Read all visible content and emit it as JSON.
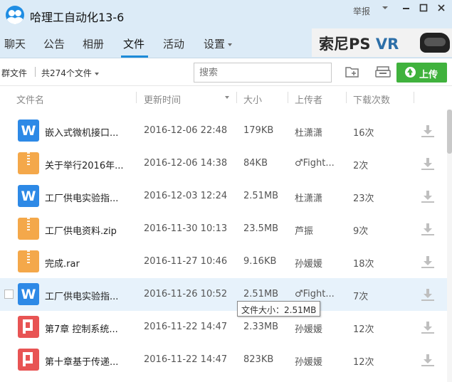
{
  "window": {
    "title": "哈理工自动化13-6",
    "report_label": "举报",
    "controls": [
      "chevron-down-icon",
      "minimize-icon",
      "maximize-icon",
      "close-icon"
    ]
  },
  "nav": {
    "tabs": [
      {
        "label": "聊天"
      },
      {
        "label": "公告"
      },
      {
        "label": "相册"
      },
      {
        "label": "文件"
      },
      {
        "label": "活动"
      },
      {
        "label": "设置"
      }
    ],
    "active_tab": "文件"
  },
  "ad": {
    "brand": "索尼PS",
    "product": "VR"
  },
  "toolbar": {
    "group_files_label": "群文件",
    "count_label": "共274个文件",
    "search_placeholder": "搜索",
    "upload_label": "上传"
  },
  "columns": {
    "name": "文件名",
    "updated": "更新时间",
    "size": "大小",
    "uploader": "上传者",
    "downloads": "下载次数"
  },
  "files": [
    {
      "type": "word",
      "name": "嵌入式微机接口...",
      "updated": "2016-12-06 22:48",
      "size": "179KB",
      "uploader": "杜潇潇",
      "downloads": "16次"
    },
    {
      "type": "zip",
      "name": "关于举行2016年...",
      "updated": "2016-12-06 14:38",
      "size": "84KB",
      "uploader": "♂Fight...",
      "downloads": "2次"
    },
    {
      "type": "word",
      "name": "工厂供电实验指...",
      "updated": "2016-12-03 12:24",
      "size": "2.51MB",
      "uploader": "杜潇潇",
      "downloads": "23次"
    },
    {
      "type": "zip",
      "name": "工厂供电资料.zip",
      "updated": "2016-11-30 10:13",
      "size": "23.5MB",
      "uploader": "芦振",
      "downloads": "9次"
    },
    {
      "type": "zip",
      "name": "完成.rar",
      "updated": "2016-11-27 10:46",
      "size": "9.16KB",
      "uploader": "孙媛媛",
      "downloads": "18次"
    },
    {
      "type": "word",
      "name": "工厂供电实验指...",
      "updated": "2016-11-26 10:52",
      "size": "2.51MB",
      "uploader": "♂Fight...",
      "downloads": "7次"
    },
    {
      "type": "ppt",
      "name": "第7章 控制系统...",
      "updated": "2016-11-22 14:47",
      "size": "2.33MB",
      "uploader": "孙媛媛",
      "downloads": "12次"
    },
    {
      "type": "ppt",
      "name": "第十章基于传递...",
      "updated": "2016-11-22 14:47",
      "size": "823KB",
      "uploader": "孙媛媛",
      "downloads": "12次"
    }
  ],
  "hovered_row": 5,
  "tooltip": "文件大小：2.51MB",
  "colors": {
    "header_bg": "#dcebf7",
    "accent_blue": "#1d8bd8",
    "upload_green": "#40b23d",
    "word_blue": "#2d89e6",
    "zip_orange": "#f4a84a",
    "ppt_red": "#e85454",
    "hover_row": "#e7f2fb"
  }
}
